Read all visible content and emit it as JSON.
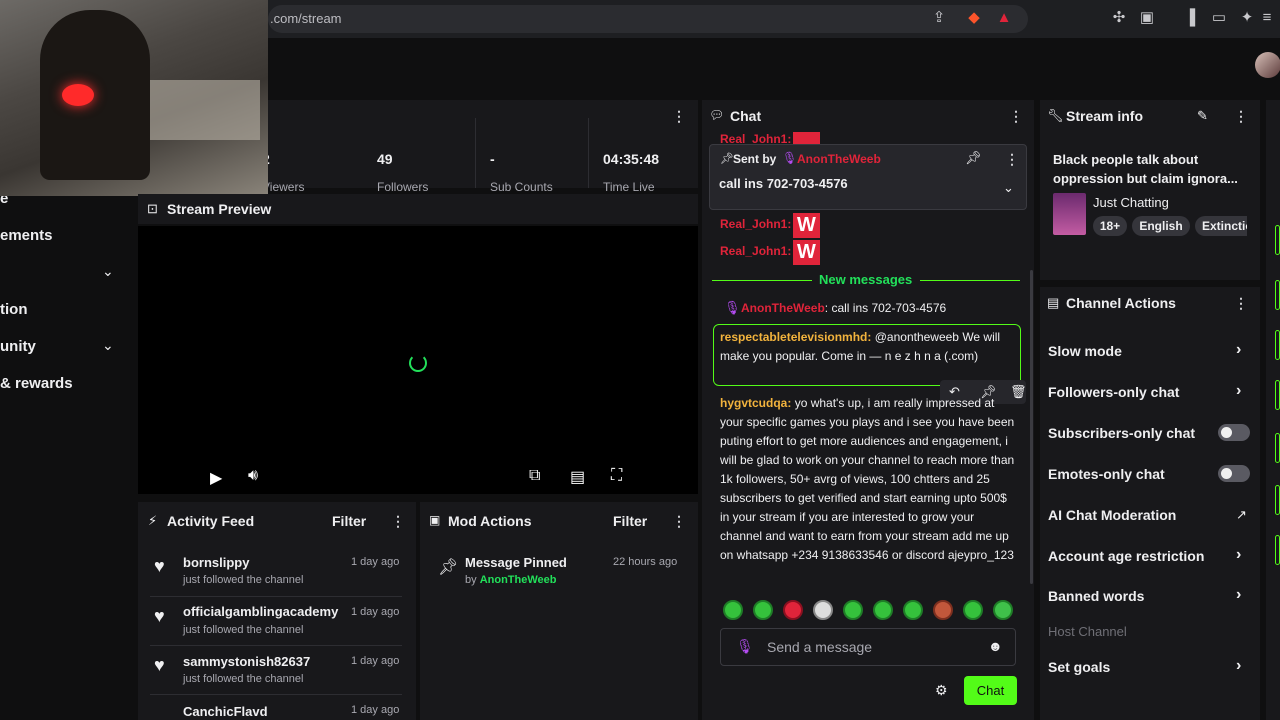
{
  "browser": {
    "url": ".com/stream"
  },
  "sidebar": {
    "items": [
      {
        "label": "e"
      },
      {
        "label": "ements"
      },
      {
        "label": "tion"
      },
      {
        "label": "unity"
      },
      {
        "label": "& rewards"
      }
    ]
  },
  "stats": {
    "viewers_value": "2",
    "viewers_label": "Viewers",
    "followers_value": "49",
    "followers_label": "Followers",
    "subs_value": "-",
    "subs_label": "Sub Counts",
    "time_value": "04:35:48",
    "time_label": "Time Live"
  },
  "preview": {
    "title": "Stream Preview"
  },
  "activity": {
    "title": "Activity Feed",
    "filter": "Filter",
    "items": [
      {
        "name": "bornslippy",
        "action": "just followed the channel",
        "time": "1 day ago"
      },
      {
        "name": "officialgamblingacademy",
        "action": "just followed the channel",
        "time": "1 day ago"
      },
      {
        "name": "sammystonish82637",
        "action": "just followed the channel",
        "time": "1 day ago"
      },
      {
        "name": "CanchicFlavd",
        "action": "",
        "time": "1 day ago"
      }
    ]
  },
  "mod": {
    "title": "Mod Actions",
    "filter": "Filter",
    "item": {
      "text": "Message Pinned",
      "by_prefix": "by",
      "by_user": "AnonTheWeeb",
      "time": "22 hours ago"
    }
  },
  "chat": {
    "title": "Chat",
    "pinned": {
      "sent_by": "Sent by",
      "user": "AnonTheWeeb",
      "text": "call ins 702-703-4576"
    },
    "top_user": "Real_John1:",
    "lines": [
      {
        "user": "Real_John1:",
        "emote": "W"
      },
      {
        "user": "Real_John1:",
        "emote": "W"
      }
    ],
    "new_messages": "New messages",
    "msg1": {
      "user": "AnonTheWeeb",
      "text": ": call ins 702-703-4576"
    },
    "msg2": {
      "user": "respectabletelevisionmhd:",
      "text": "@anontheweeb We will make you popular. Come in — n e z h n a (.com)"
    },
    "msg3": {
      "user": "hygvtcudqa:",
      "text": "yo what's up, i am really impressed at your specific games you plays and i see you have been puting effort to get more audiences and engagement, i will be glad to work on your channel to reach more than 1k followers, 50+ avrg of views, 100 chtters and 25 subscribers to get verified and start earning upto 500$ in your stream if you are interested to grow your channel and want to earn from your stream add me up on whatsapp +234 9138633546 or discord ajeypro_123"
    },
    "input_placeholder": "Send a message",
    "send": "Chat"
  },
  "streaminfo": {
    "title": "Stream info",
    "stream_title": "Black people talk about oppression but claim ignora...",
    "category": "Just Chatting",
    "tags": [
      "18+",
      "English",
      "Extinctio"
    ]
  },
  "channel_actions": {
    "title": "Channel Actions",
    "items": [
      {
        "label": "Slow mode"
      },
      {
        "label": "Followers-only chat"
      },
      {
        "label": "Subscribers-only chat"
      },
      {
        "label": "Emotes-only chat"
      },
      {
        "label": "AI Chat Moderation"
      },
      {
        "label": "Account age restriction"
      },
      {
        "label": "Banned words"
      },
      {
        "label": "Host Channel"
      },
      {
        "label": "Set goals"
      }
    ]
  },
  "colors": {
    "accent": "#53fc18",
    "panel": "#18181b",
    "bg": "#0f0f10"
  }
}
